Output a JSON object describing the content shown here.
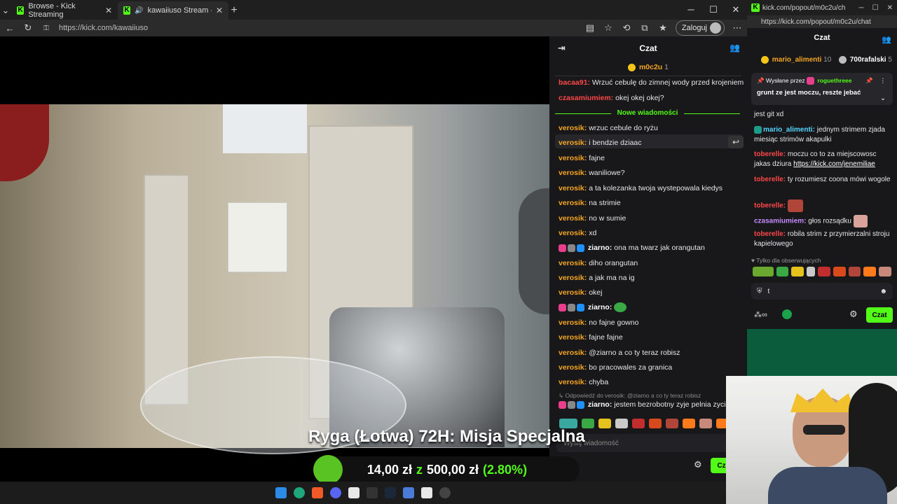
{
  "browser": {
    "tabs": [
      {
        "title": "Browse - Kick Streaming"
      },
      {
        "title": "kawaiiuso Stream - Watch Liv"
      }
    ],
    "url": "https://kick.com/kawaiiuso",
    "login_label": "Zaloguj"
  },
  "stream": {
    "overlay_title": "Ryga (Łotwa) 72H: Misja Specjalna",
    "goal_current": "14,00 zł",
    "goal_sep": "z",
    "goal_target": "500,00 zł",
    "goal_percent": "(2.80%)",
    "goal_fraction": 0.028
  },
  "chat": {
    "title": "Czat",
    "top_user": "m0c2u",
    "top_count": "1",
    "new_messages_label": "Nowe wiadomości",
    "messages": [
      {
        "user": "bacaa91",
        "text": "Wrzuć cebulę do zimnej wody przed krojeniem"
      },
      {
        "user": "czasamiumiem",
        "text": "okej okej okej?"
      },
      {
        "user": "verosik",
        "text": "wrzuc cebule do ryżu"
      },
      {
        "user": "verosik",
        "text": "i bendzie dziaac"
      },
      {
        "user": "verosik",
        "text": "fajne"
      },
      {
        "user": "verosik",
        "text": "waniliowe?"
      },
      {
        "user": "verosik",
        "text": "a ta kolezanka twoja wystepowala kiedys"
      },
      {
        "user": "verosik",
        "text": "na strimie"
      },
      {
        "user": "verosik",
        "text": "no w sumie"
      },
      {
        "user": "verosik",
        "text": "xd"
      },
      {
        "user": "ziarno",
        "text": "ona ma twarz jak orangutan"
      },
      {
        "user": "verosik",
        "text": "diho orangutan"
      },
      {
        "user": "verosik",
        "text": "a jak ma na ig"
      },
      {
        "user": "verosik",
        "text": "okej"
      },
      {
        "user": "ziarno",
        "text": ""
      },
      {
        "user": "verosik",
        "text": "no fajne gowno"
      },
      {
        "user": "verosik",
        "text": "fajne fajne"
      },
      {
        "user": "verosik",
        "text": "@ziarno a co ty teraz robisz"
      },
      {
        "user": "verosik",
        "text": "bo pracowales za granica"
      },
      {
        "user": "verosik",
        "text": "chyba"
      }
    ],
    "reply_context": "Odpowiedź do verosik: @ziarno a co ty teraz robisz",
    "reply_user": "ziarno",
    "reply_text": "jestem bezrobotny zyje pelnia zycia",
    "input_placeholder": "Wyślij wiadomość",
    "counter": "0",
    "send_label": "Czat"
  },
  "popout": {
    "window_url": "kick.com/popout/m0c2u/ch",
    "url": "https://kick.com/popout/m0c2u/chat",
    "title": "Czat",
    "leaderboard": [
      {
        "user": "mario_alimenti",
        "count": "10"
      },
      {
        "user": "700rafalski",
        "count": "5"
      }
    ],
    "pinned_by_label": "Wysłane przez",
    "pinned_user": "roguethreee",
    "pinned_text": "grunt ze jest moczu, reszte jebać",
    "messages": [
      {
        "user": "",
        "text": "jest git xd"
      },
      {
        "user": "mario_alimenti",
        "text": "jednym strimem zjada miesiąc strimów akapulki"
      },
      {
        "user": "toberelle",
        "text": "moczu co to za miejscowosc jakas dziura",
        "link": "https://kick.com/jenemiliae"
      },
      {
        "user": "toberelle",
        "text": "ty rozumiesz coona mówi wogole"
      },
      {
        "user": "toberelle",
        "text": ""
      },
      {
        "user": "czasamiumiem",
        "text": "głos rozsądku"
      },
      {
        "user": "toberelle",
        "text": "robila strim z przymierzalni stroju kapielowego"
      }
    ],
    "followers_only": "Tylko dla obserwujących",
    "input_value": "t",
    "send_label": "Czat"
  },
  "colors": {
    "kick_green": "#53fc18",
    "chat_bg": "#18181b",
    "verosik": "#f5a623",
    "ziarno": "#ffffff",
    "red_user": "#ff4747"
  }
}
